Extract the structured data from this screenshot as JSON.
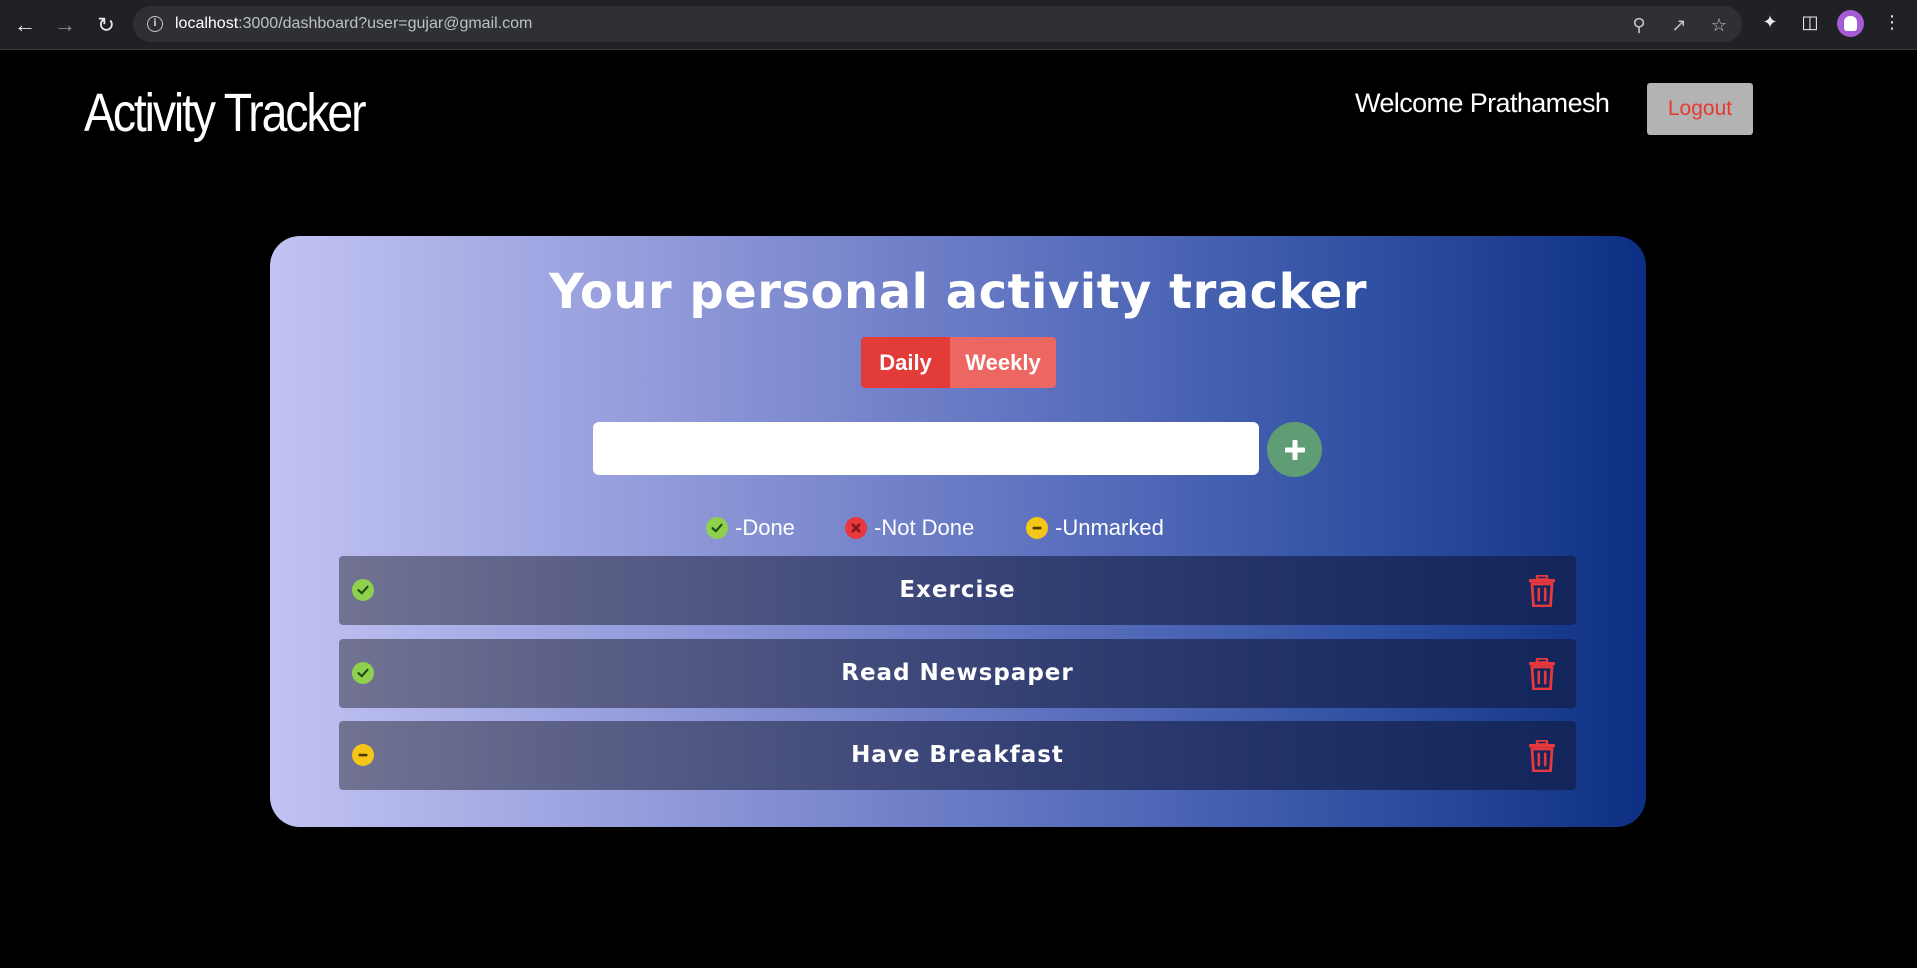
{
  "browser": {
    "url_host": "localhost",
    "url_rest": ":3000/dashboard?user=gujar@gmail.com"
  },
  "header": {
    "app_title": "Activity Tracker",
    "welcome_text": "Welcome Prathamesh",
    "logout_label": "Logout"
  },
  "tracker": {
    "title": "Your personal activity tracker",
    "tabs": [
      {
        "label": "Daily",
        "active": true
      },
      {
        "label": "Weekly",
        "active": false
      }
    ],
    "input": {
      "value": "",
      "placeholder": ""
    },
    "add_icon": "plus-icon",
    "legend": [
      {
        "icon": "check-circle-icon",
        "label": "-Done",
        "color": "#8fd14f"
      },
      {
        "icon": "x-circle-icon",
        "label": "-Not Done",
        "color": "#e8383d"
      },
      {
        "icon": "minus-circle-icon",
        "label": "-Unmarked",
        "color": "#f5c518"
      }
    ],
    "activities": [
      {
        "name": "Exercise",
        "status": "done"
      },
      {
        "name": "Read Newspaper",
        "status": "done"
      },
      {
        "name": "Have Breakfast",
        "status": "unmarked"
      }
    ]
  },
  "colors": {
    "done": "#8fd14f",
    "not_done": "#e8383d",
    "unmarked": "#f5c518",
    "delete": "#e8383d",
    "daily_tab": "#e33b37",
    "weekly_tab": "#ec6662",
    "add_button": "#5f9e74"
  }
}
